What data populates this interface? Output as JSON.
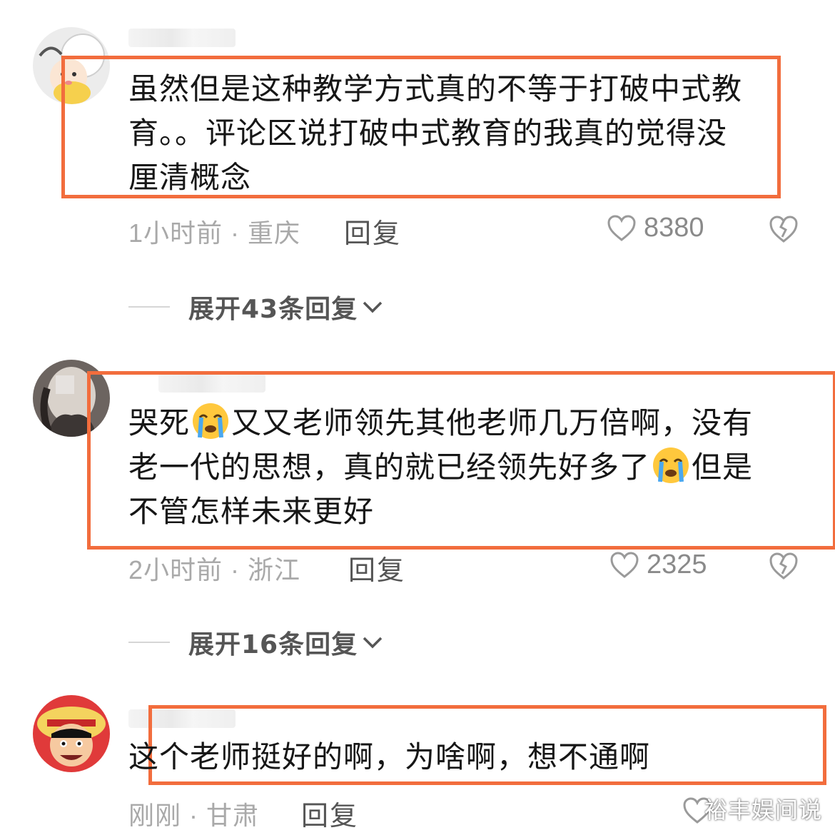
{
  "comments": [
    {
      "text": "虽然但是这种教学方式真的不等于打破中式教\n育。。评论区说打破中式教育的我真的觉得没\n厘清概念",
      "time_location": "1小时前 · 重庆",
      "reply_label": "回复",
      "likes": "8380",
      "expand_label": "展开43条回复"
    },
    {
      "text_part1": "哭死",
      "text_part2": "又又老师领先其他老师几万倍啊，没有\n老一代的思想，真的就已经领先好多了",
      "text_part3": "但是\n不管怎样未来更好",
      "time_location": "2小时前 · 浙江",
      "reply_label": "回复",
      "likes": "2325",
      "expand_label": "展开16条回复"
    },
    {
      "text": "这个老师挺好的啊，为啥啊，想不通啊",
      "time_location": "刚刚 · 甘肃",
      "reply_label": "回复"
    }
  ],
  "watermark": "裕丰娱间说",
  "colors": {
    "highlight": "#f26d3d",
    "meta_gray": "#a9a9a9",
    "text": "#161616"
  },
  "icons": [
    "heart-icon",
    "broken-heart-icon",
    "chevron-down-icon",
    "crying-emoji-icon"
  ]
}
